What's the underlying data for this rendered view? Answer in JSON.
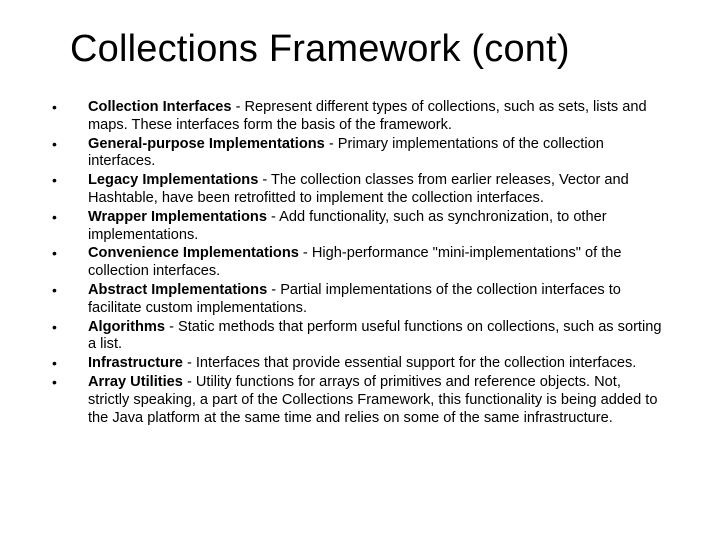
{
  "title": "Collections Framework (cont)",
  "items": [
    {
      "term": "Collection Interfaces",
      "desc": " - Represent different types of collections, such as sets, lists and maps. These interfaces form the basis of the framework."
    },
    {
      "term": "General-purpose Implementations",
      "desc": " - Primary implementations of the collection interfaces."
    },
    {
      "term": "Legacy Implementations",
      "desc": " - The collection classes from earlier releases, Vector and Hashtable, have been retrofitted to implement the collection interfaces."
    },
    {
      "term": "Wrapper Implementations",
      "desc": " - Add functionality, such as synchronization, to other implementations."
    },
    {
      "term": "Convenience Implementations",
      "desc": " - High-performance \"mini-implementations\" of the collection interfaces."
    },
    {
      "term": "Abstract Implementations",
      "desc": " - Partial implementations of the collection interfaces to facilitate custom implementations."
    },
    {
      "term": "Algorithms",
      "desc": " - Static methods that perform useful functions on collections, such as sorting a list."
    },
    {
      "term": "Infrastructure",
      "desc": " - Interfaces that provide essential support for the collection interfaces."
    },
    {
      "term": "Array Utilities",
      "desc": " - Utility functions for arrays of primitives and reference objects. Not, strictly speaking, a part of the Collections Framework, this functionality is being added to the Java platform at the same time and relies on some of the same infrastructure."
    }
  ]
}
